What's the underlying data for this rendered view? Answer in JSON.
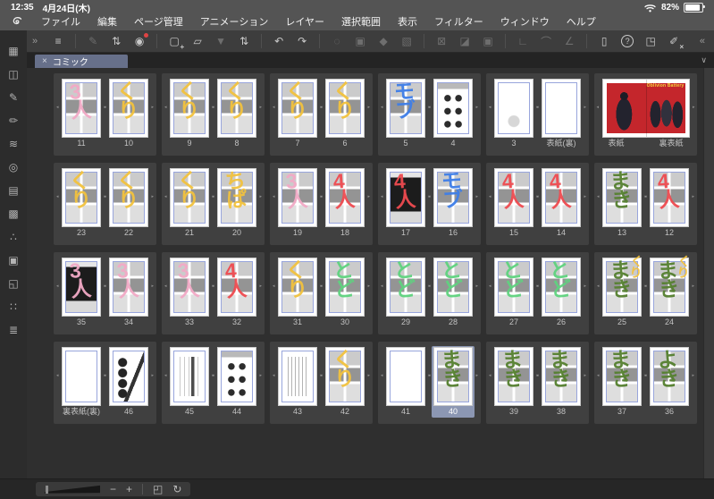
{
  "status_bar": {
    "time": "12:35",
    "date": "4月24日(木)",
    "battery_percent": "82%",
    "battery_level": 0.82
  },
  "menu_bar": {
    "items": [
      "ファイル",
      "編集",
      "ページ管理",
      "アニメーション",
      "レイヤー",
      "選択範囲",
      "表示",
      "フィルター",
      "ウィンドウ",
      "ヘルプ"
    ]
  },
  "toolbar": {
    "collapse_left": "»",
    "collapse_right": "«",
    "groups": [
      [
        {
          "name": "main-menu",
          "glyph": "≡",
          "enabled": true
        }
      ],
      [
        {
          "name": "edit-brush",
          "glyph": "✎",
          "enabled": false
        },
        {
          "name": "palette-cycle",
          "glyph": "⇅",
          "enabled": true
        },
        {
          "name": "clip-studio",
          "glyph": "◉",
          "enabled": true,
          "badge": "dot"
        }
      ],
      [
        {
          "name": "new-canvas",
          "glyph": "▢",
          "enabled": true,
          "badge": "+"
        },
        {
          "name": "open-file",
          "glyph": "▱",
          "enabled": true
        },
        {
          "name": "save",
          "glyph": "▼",
          "enabled": false
        },
        {
          "name": "save-cycle",
          "glyph": "⇅",
          "enabled": true
        }
      ],
      [
        {
          "name": "undo",
          "glyph": "↶",
          "enabled": true
        },
        {
          "name": "redo",
          "glyph": "↷",
          "enabled": true
        }
      ],
      [
        {
          "name": "refresh",
          "glyph": "◌",
          "enabled": false
        },
        {
          "name": "paste",
          "glyph": "▣",
          "enabled": false
        },
        {
          "name": "figure",
          "glyph": "◆",
          "enabled": false
        },
        {
          "name": "transform",
          "glyph": "▧",
          "enabled": false
        }
      ],
      [
        {
          "name": "deselect",
          "glyph": "⊠",
          "enabled": false
        },
        {
          "name": "invert-selection",
          "glyph": "◪",
          "enabled": false
        },
        {
          "name": "selection-launcher",
          "glyph": "▣",
          "enabled": false
        }
      ],
      [
        {
          "name": "snap-ruler",
          "glyph": "∟",
          "enabled": false
        },
        {
          "name": "snap-special-ruler",
          "glyph": "⌒",
          "enabled": false
        },
        {
          "name": "snap-grid",
          "glyph": "∠",
          "enabled": false
        }
      ],
      [
        {
          "name": "device",
          "glyph": "▯",
          "enabled": true
        },
        {
          "name": "help",
          "glyph": "?",
          "enabled": true,
          "circled": true
        },
        {
          "name": "fullscreen",
          "glyph": "◳",
          "enabled": true
        },
        {
          "name": "pen-settings",
          "glyph": "✐",
          "enabled": true,
          "badge": "×"
        }
      ]
    ]
  },
  "tab": {
    "label": "コミック",
    "close_glyph": "×",
    "overflow_glyph": "∨",
    "selected_color": "#67708a"
  },
  "sidebar": {
    "icons": [
      {
        "name": "palette-tool-list",
        "glyph": "▦"
      },
      {
        "name": "palette-quick-access",
        "glyph": "◫"
      },
      {
        "name": "palette-pen-tool",
        "glyph": "✎"
      },
      {
        "name": "palette-sub-tool",
        "glyph": "✏"
      },
      {
        "name": "palette-tool-property",
        "glyph": "≋"
      },
      {
        "name": "palette-color-wheel",
        "glyph": "◎"
      },
      {
        "name": "palette-timeline",
        "glyph": "▤"
      },
      {
        "name": "palette-color-set",
        "glyph": "▩"
      },
      {
        "name": "palette-color-mix",
        "glyph": "∴"
      },
      {
        "name": "palette-layer-property",
        "glyph": "▣"
      },
      {
        "name": "palette-navigator",
        "glyph": "◱"
      },
      {
        "name": "palette-material",
        "glyph": "∷"
      },
      {
        "name": "palette-layer",
        "glyph": "≣"
      }
    ]
  },
  "scribble_colors": {
    "pink": "#f2aac6",
    "yellow": "#f2c23e",
    "blue": "#3e7ee8",
    "red": "#ef4b50",
    "green_light": "#5fd37f",
    "green_dark": "#55802f"
  },
  "selection_color": "#8c97b3",
  "cover": {
    "title": "Oblivion Battery",
    "background": "#c4262c"
  },
  "pages": {
    "rows": [
      {
        "panels": [
          {
            "pages": [
              {
                "label": "11",
                "kind": "manga",
                "scribbles": [
                  {
                    "text": "3人",
                    "color": "#f2aac6"
                  }
                ]
              },
              {
                "label": "10",
                "kind": "manga",
                "scribbles": [
                  {
                    "text": "くり",
                    "color": "#f2c23e"
                  }
                ]
              }
            ]
          },
          {
            "pages": [
              {
                "label": "9",
                "kind": "manga",
                "scribbles": [
                  {
                    "text": "くり",
                    "color": "#f2c23e"
                  }
                ]
              },
              {
                "label": "8",
                "kind": "manga",
                "scribbles": [
                  {
                    "text": "くり",
                    "color": "#f2c23e"
                  }
                ]
              }
            ]
          },
          {
            "pages": [
              {
                "label": "7",
                "kind": "manga",
                "scribbles": [
                  {
                    "text": "くり",
                    "color": "#f2c23e"
                  }
                ]
              },
              {
                "label": "6",
                "kind": "manga",
                "scribbles": [
                  {
                    "text": "くり",
                    "color": "#f2c23e"
                  }
                ]
              }
            ]
          },
          {
            "pages": [
              {
                "label": "5",
                "kind": "manga",
                "scribbles": [
                  {
                    "text": "モブ",
                    "color": "#3e7ee8"
                  }
                ]
              },
              {
                "label": "4",
                "kind": "faces",
                "scribbles": []
              }
            ]
          },
          {
            "pages": [
              {
                "label": "3",
                "kind": "sketch",
                "scribbles": []
              },
              {
                "label": "表紙(裏)",
                "kind": "blank",
                "scribbles": []
              }
            ]
          },
          {
            "type": "spread",
            "kind": "cover",
            "labels": [
              "表紙",
              "裏表紙"
            ]
          }
        ]
      },
      {
        "panels": [
          {
            "pages": [
              {
                "label": "23",
                "kind": "manga",
                "scribbles": [
                  {
                    "text": "くり",
                    "color": "#f2c23e"
                  }
                ]
              },
              {
                "label": "22",
                "kind": "manga",
                "scribbles": [
                  {
                    "text": "くり",
                    "color": "#f2c23e"
                  }
                ]
              }
            ]
          },
          {
            "pages": [
              {
                "label": "21",
                "kind": "manga",
                "scribbles": [
                  {
                    "text": "くり",
                    "color": "#f2c23e"
                  }
                ]
              },
              {
                "label": "20",
                "kind": "manga",
                "scribbles": [
                  {
                    "text": "ちぱ",
                    "color": "#f2c23e"
                  }
                ]
              }
            ]
          },
          {
            "pages": [
              {
                "label": "19",
                "kind": "manga",
                "scribbles": [
                  {
                    "text": "3人",
                    "color": "#f2aac6"
                  }
                ]
              },
              {
                "label": "18",
                "kind": "manga",
                "scribbles": [
                  {
                    "text": "4人",
                    "color": "#ef4b50"
                  }
                ]
              }
            ]
          },
          {
            "pages": [
              {
                "label": "17",
                "kind": "dark",
                "scribbles": [
                  {
                    "text": "4人",
                    "color": "#ef4b50"
                  }
                ]
              },
              {
                "label": "16",
                "kind": "manga",
                "scribbles": [
                  {
                    "text": "モブ",
                    "color": "#3e7ee8"
                  }
                ]
              }
            ]
          },
          {
            "pages": [
              {
                "label": "15",
                "kind": "manga",
                "scribbles": [
                  {
                    "text": "4人",
                    "color": "#ef4b50"
                  }
                ]
              },
              {
                "label": "14",
                "kind": "manga",
                "scribbles": [
                  {
                    "text": "4人",
                    "color": "#ef4b50"
                  }
                ]
              }
            ]
          },
          {
            "pages": [
              {
                "label": "13",
                "kind": "manga",
                "scribbles": [
                  {
                    "text": "まき",
                    "color": "#55802f"
                  }
                ]
              },
              {
                "label": "12",
                "kind": "manga",
                "scribbles": [
                  {
                    "text": "4人",
                    "color": "#ef4b50"
                  }
                ]
              }
            ]
          }
        ]
      },
      {
        "panels": [
          {
            "pages": [
              {
                "label": "35",
                "kind": "dark",
                "scribbles": [
                  {
                    "text": "3人",
                    "color": "#f2aac6"
                  }
                ]
              },
              {
                "label": "34",
                "kind": "manga",
                "scribbles": [
                  {
                    "text": "3人",
                    "color": "#f2aac6"
                  }
                ]
              }
            ]
          },
          {
            "pages": [
              {
                "label": "33",
                "kind": "manga",
                "scribbles": [
                  {
                    "text": "3人",
                    "color": "#f2aac6"
                  }
                ]
              },
              {
                "label": "32",
                "kind": "manga",
                "scribbles": [
                  {
                    "text": "4人",
                    "color": "#ef4b50"
                  }
                ]
              }
            ]
          },
          {
            "pages": [
              {
                "label": "31",
                "kind": "manga",
                "scribbles": [
                  {
                    "text": "くり",
                    "color": "#f2c23e"
                  }
                ]
              },
              {
                "label": "30",
                "kind": "manga",
                "scribbles": [
                  {
                    "text": "とど",
                    "color": "#5fd37f"
                  }
                ]
              }
            ]
          },
          {
            "pages": [
              {
                "label": "29",
                "kind": "manga",
                "scribbles": [
                  {
                    "text": "とど",
                    "color": "#5fd37f"
                  }
                ]
              },
              {
                "label": "28",
                "kind": "manga",
                "scribbles": [
                  {
                    "text": "とど",
                    "color": "#5fd37f"
                  }
                ]
              }
            ]
          },
          {
            "pages": [
              {
                "label": "27",
                "kind": "manga",
                "scribbles": [
                  {
                    "text": "とど",
                    "color": "#5fd37f"
                  }
                ]
              },
              {
                "label": "26",
                "kind": "manga",
                "scribbles": [
                  {
                    "text": "とど",
                    "color": "#5fd37f"
                  }
                ]
              }
            ]
          },
          {
            "pages": [
              {
                "label": "25",
                "kind": "manga",
                "scribbles": [
                  {
                    "text": "まき",
                    "color": "#55802f"
                  },
                  {
                    "text": "くり",
                    "color": "#f2c23e"
                  }
                ]
              },
              {
                "label": "24",
                "kind": "manga",
                "scribbles": [
                  {
                    "text": "まき",
                    "color": "#55802f"
                  },
                  {
                    "text": "くり",
                    "color": "#f2c23e"
                  }
                ]
              }
            ]
          }
        ]
      },
      {
        "panels": [
          {
            "pages": [
              {
                "label": "裏表紙(裏)",
                "kind": "blank",
                "scribbles": []
              },
              {
                "label": "46",
                "kind": "food",
                "scribbles": []
              }
            ]
          },
          {
            "pages": [
              {
                "label": "45",
                "kind": "texttitle",
                "scribbles": []
              },
              {
                "label": "44",
                "kind": "faces",
                "scribbles": []
              }
            ]
          },
          {
            "pages": [
              {
                "label": "43",
                "kind": "text",
                "scribbles": []
              },
              {
                "label": "42",
                "kind": "manga",
                "scribbles": [
                  {
                    "text": "くり",
                    "color": "#f2c23e"
                  }
                ]
              }
            ]
          },
          {
            "pages": [
              {
                "label": "41",
                "kind": "blank",
                "scribbles": []
              },
              {
                "label": "40",
                "kind": "manga",
                "selected": true,
                "scribbles": [
                  {
                    "text": "まき",
                    "color": "#55802f"
                  }
                ]
              }
            ]
          },
          {
            "pages": [
              {
                "label": "39",
                "kind": "manga",
                "scribbles": [
                  {
                    "text": "まき",
                    "color": "#55802f"
                  }
                ]
              },
              {
                "label": "38",
                "kind": "manga",
                "scribbles": [
                  {
                    "text": "まき",
                    "color": "#55802f"
                  }
                ]
              }
            ]
          },
          {
            "pages": [
              {
                "label": "37",
                "kind": "manga",
                "scribbles": [
                  {
                    "text": "まき",
                    "color": "#55802f"
                  }
                ]
              },
              {
                "label": "36",
                "kind": "manga",
                "scribbles": [
                  {
                    "text": "よき",
                    "color": "#55802f"
                  }
                ]
              }
            ]
          }
        ]
      }
    ]
  },
  "bottom_bar": {
    "zoom_out": "−",
    "zoom_in": "+",
    "fit_glyph": "◰",
    "rotate_glyph": "↻"
  }
}
